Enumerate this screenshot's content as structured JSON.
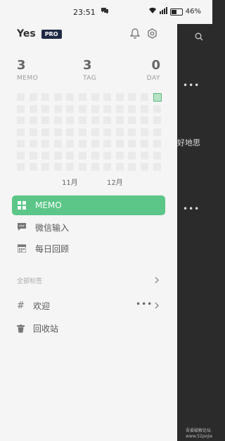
{
  "status_bar": {
    "time": "23:51",
    "battery": "46%"
  },
  "drawer": {
    "app_title": "Yes",
    "badge": "PRO",
    "stats": [
      {
        "value": "3",
        "label": "MEMO"
      },
      {
        "value": "3",
        "label": "TAG"
      },
      {
        "value": "0",
        "label": "DAY"
      }
    ],
    "heatmap": {
      "columns": 12,
      "rows": 7,
      "active_cell": {
        "col": 11,
        "row": 0
      },
      "months": [
        "11月",
        "12月"
      ]
    },
    "nav": [
      {
        "label": "MEMO",
        "icon": "grid-icon",
        "active": true
      },
      {
        "label": "微信输入",
        "icon": "chat-icon",
        "active": false
      },
      {
        "label": "每日回顾",
        "icon": "calendar-icon",
        "active": false
      }
    ],
    "section_label": "全部标签",
    "tags": [
      {
        "label": "欢迎",
        "icon": "hash-icon"
      }
    ],
    "trash_label": "回收站"
  },
  "background_panel": {
    "partial_text": "好地思",
    "footer_line1": "吾爱破解论坛",
    "footer_line2": "www.52pojie.cn"
  },
  "colors": {
    "accent": "#5bc687",
    "badge_bg": "#1e2a44",
    "drawer_bg": "#f5f5f5",
    "overlay_bg": "#2b2b2b"
  }
}
